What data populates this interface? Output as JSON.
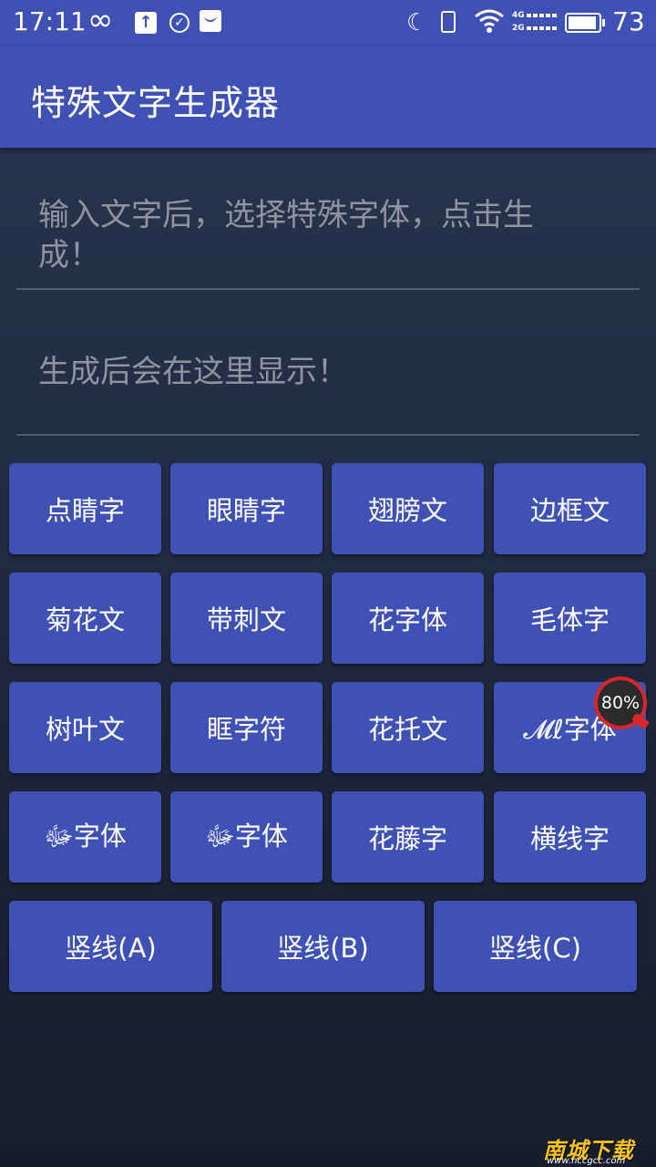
{
  "status_bar": {
    "time": "17:11",
    "battery_level": "73",
    "signal_4g": "4G",
    "signal_2g": "2G",
    "icons": [
      "infinity-icon",
      "upload-icon",
      "check-circle-icon",
      "bag-icon",
      "moon-icon",
      "vibrate-icon",
      "wifi-icon",
      "signal-icon",
      "battery-icon"
    ]
  },
  "app_bar": {
    "title": "特殊文字生成器"
  },
  "input_field": {
    "placeholder": "输入文字后，选择特殊字体，点击生成！"
  },
  "output_field": {
    "placeholder": "生成后会在这里显示！"
  },
  "buttons": {
    "row1": [
      "点睛字",
      "眼睛字",
      "翅膀文",
      "边框文"
    ],
    "row2": [
      "菊花文",
      "带刺文",
      "花字体",
      "毛体字"
    ],
    "row3": [
      "树叶文",
      "眶字符",
      "花托文",
      "𝓜ℓ字体"
    ],
    "row4": [
      "ﷻ字体",
      "ﷻ字体",
      "花藤字",
      "横线字"
    ],
    "row5": [
      "竖线(A)",
      "竖线(B)",
      "竖线(C)"
    ]
  },
  "float_badge": {
    "label": "80%"
  },
  "watermark": {
    "brand": "南城下载",
    "url": "www.nccgcc.com"
  },
  "colors": {
    "primary": "#3f51b5",
    "background": "#222c44",
    "badge_ring": "#d8262a",
    "watermark": "#f6c21c"
  }
}
